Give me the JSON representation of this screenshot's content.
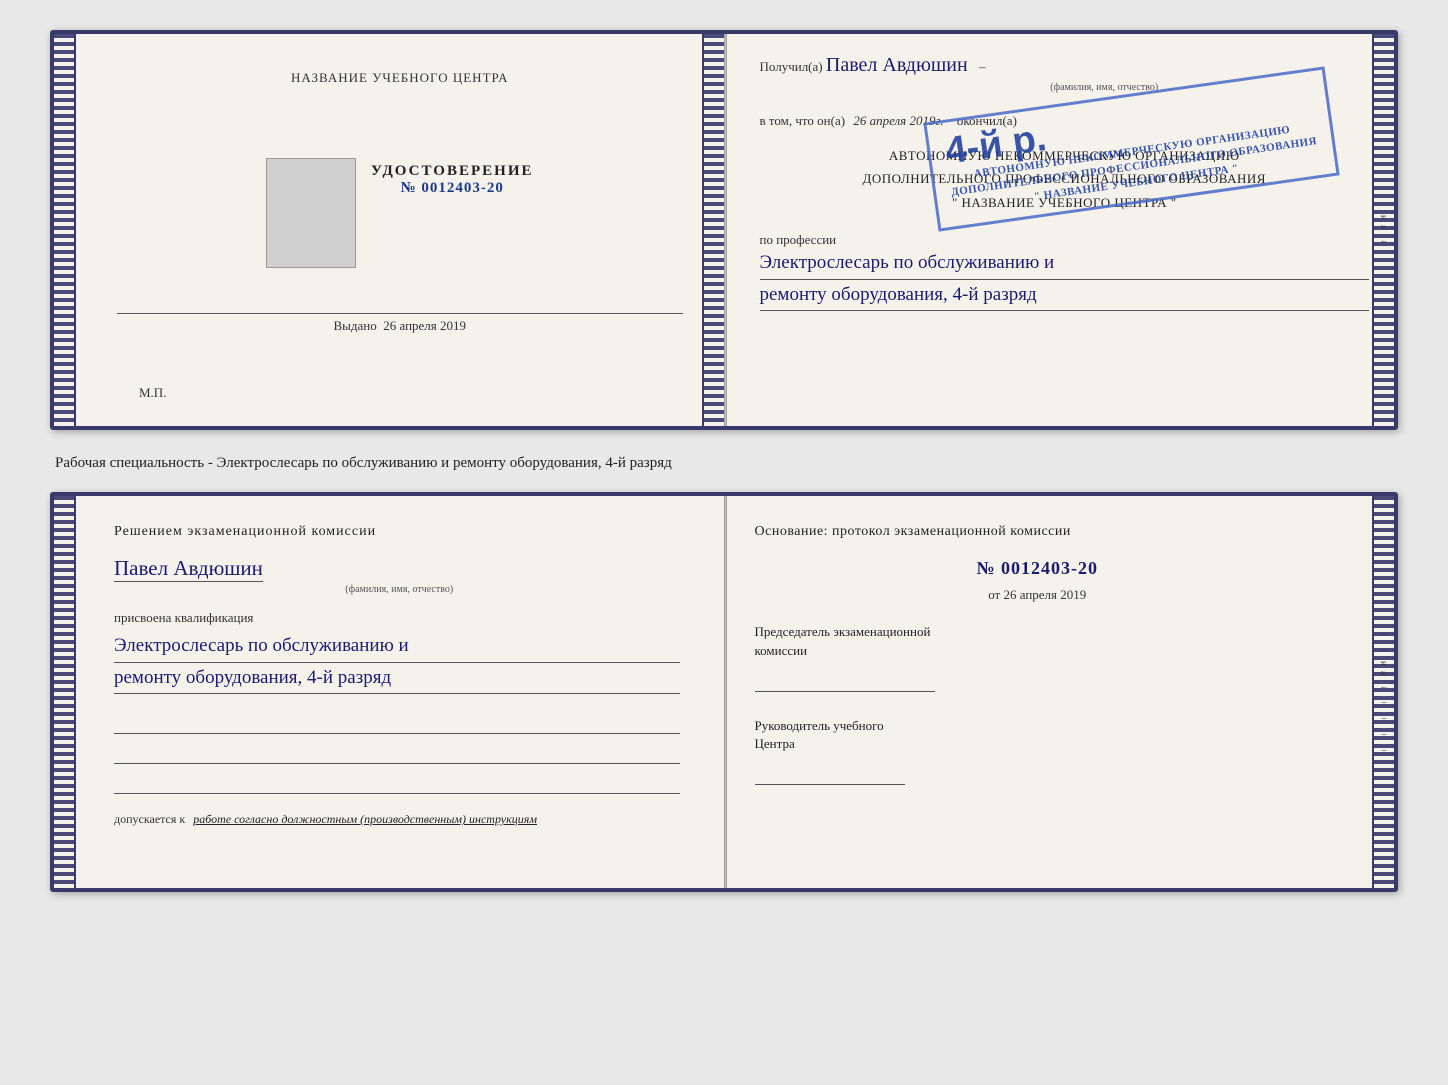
{
  "top_doc": {
    "left": {
      "center_title": "НАЗВАНИЕ УЧЕБНОГО ЦЕНТРА",
      "cert_label": "УДОСТОВЕРЕНИЕ",
      "cert_number": "№ 0012403-20",
      "issued_label": "Выдано",
      "issued_date": "26 апреля 2019",
      "mp_label": "М.П."
    },
    "right": {
      "received_prefix": "Получил(а)",
      "received_name": "Павел Авдюшин",
      "fio_subtitle": "(фамилия, имя, отчество)",
      "vtom_prefix": "в том, что он(а)",
      "vtom_date": "26 апреля 2019г.",
      "okonchil_label": "окончил(а)",
      "stamp_big": "4-й р.",
      "stamp_line1": "АВТОНОМНУЮ НЕКОММЕРЧЕСКУЮ ОРГАНИЗАЦИЮ",
      "stamp_line2": "ДОПОЛНИТЕЛЬНОГО ПРОФЕССИОНАЛЬНОГО ОБРАЗОВАНИЯ",
      "stamp_line3": "\" НАЗВАНИЕ УЧЕБНОГО ЦЕНТРА \"",
      "po_professii": "по профессии",
      "profession_line1": "Электрослесарь по обслуживанию и",
      "profession_line2": "ремонту оборудования, 4-й разряд"
    }
  },
  "middle_text": "Рабочая специальность - Электрослесарь по обслуживанию и ремонту оборудования, 4-й\nразряд",
  "bottom_doc": {
    "left": {
      "decision_title": "Решением экзаменационной комиссии",
      "person_name": "Павел Авдюшин",
      "fio_subtitle": "(фамилия, имя, отчество)",
      "assigned_label": "присвоена квалификация",
      "qual_line1": "Электрослесарь по обслуживанию и",
      "qual_line2": "ремонту оборудования, 4-й разряд",
      "допускается_prefix": "допускается к",
      "допускается_text": "работе согласно должностным (производственным) инструкциям"
    },
    "right": {
      "osnov_title": "Основание: протокол экзаменационной комиссии",
      "protocol_number": "№ 0012403-20",
      "from_prefix": "от",
      "from_date": "26 апреля 2019",
      "chairman_title": "Председатель экзаменационной\nкомиссии",
      "director_title": "Руководитель учебного\nЦентра"
    }
  },
  "side_marks": {
    "marks": [
      "и",
      "а",
      "←",
      "–",
      "–",
      "–",
      "–",
      "–",
      "–",
      "–"
    ]
  }
}
